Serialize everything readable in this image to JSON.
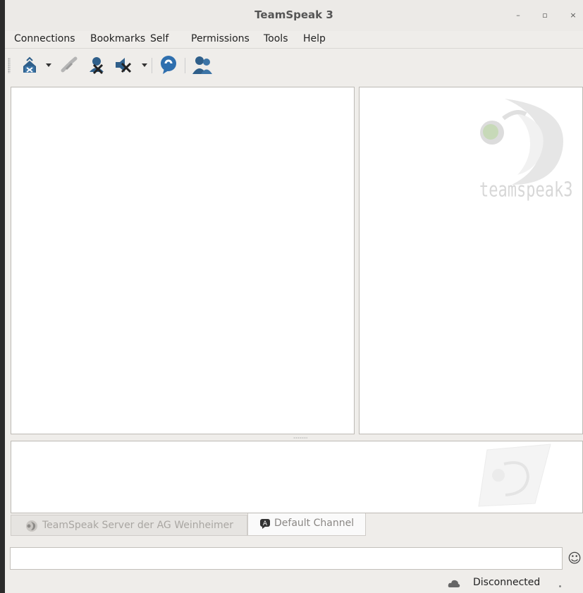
{
  "window": {
    "title": "TeamSpeak 3",
    "minimize_glyph": "–",
    "maximize_glyph": "▫",
    "close_glyph": "×"
  },
  "menu": {
    "items": [
      {
        "label": "Connections"
      },
      {
        "label": "Bookmarks"
      },
      {
        "label": "Self"
      },
      {
        "label": "Permissions"
      },
      {
        "label": "Tools"
      },
      {
        "label": "Help"
      }
    ]
  },
  "toolbar": {
    "buttons": [
      {
        "icon": "connect-icon",
        "has_dropdown": true
      },
      {
        "icon": "disconnect-icon",
        "has_dropdown": false,
        "disabled": true
      },
      {
        "icon": "mute-microphone-icon",
        "has_dropdown": false
      },
      {
        "icon": "mute-speakers-icon",
        "has_dropdown": true
      },
      {
        "icon": "away-chat-icon",
        "has_dropdown": false
      },
      {
        "icon": "contacts-icon",
        "has_dropdown": false
      }
    ]
  },
  "branding": {
    "logo_text": "teamspeak3"
  },
  "tabs": [
    {
      "label": "TeamSpeak Server der AG Weinheimer",
      "icon": "server-icon",
      "active": false
    },
    {
      "label": "Default Channel",
      "icon": "channel-icon",
      "active": true
    }
  ],
  "chat": {
    "input_value": "",
    "emoji_glyph": "☺"
  },
  "status": {
    "text": "Disconnected",
    "icon": "cloud-status-icon"
  },
  "colors": {
    "accent": "#2a6a9e",
    "icon_blue": "#2f5f8a"
  }
}
